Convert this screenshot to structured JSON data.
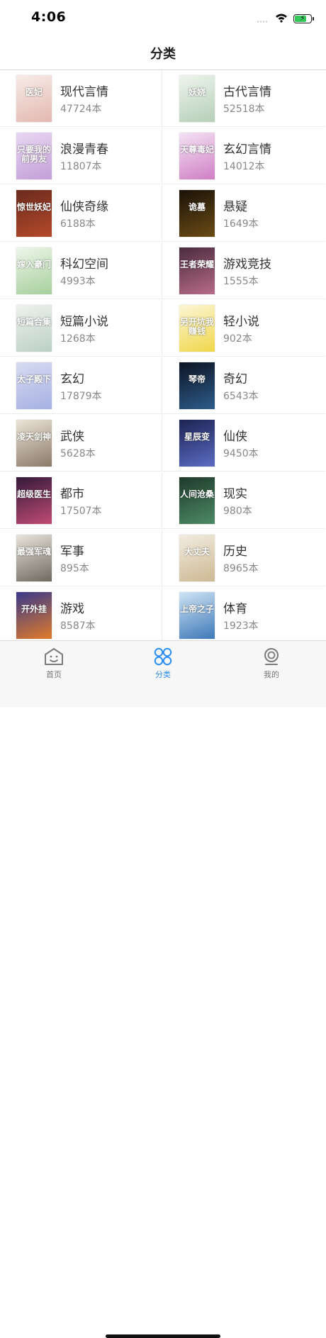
{
  "status": {
    "time": "4:06"
  },
  "nav": {
    "title": "分类"
  },
  "categories": [
    {
      "name": "现代言情",
      "count": "47724本",
      "cover_text": "医妃",
      "cover_colors": [
        "#f7ece8",
        "#e3b8b0"
      ]
    },
    {
      "name": "古代言情",
      "count": "52518本",
      "cover_text": "妖娆",
      "cover_colors": [
        "#eef4ec",
        "#b6cfb8"
      ]
    },
    {
      "name": "浪漫青春",
      "count": "11807本",
      "cover_text": "只要我的前男友",
      "cover_colors": [
        "#e8d7f2",
        "#c39fd8"
      ]
    },
    {
      "name": "玄幻言情",
      "count": "14012本",
      "cover_text": "天尊毒妃",
      "cover_colors": [
        "#f3e3f4",
        "#d07fc4"
      ]
    },
    {
      "name": "仙侠奇缘",
      "count": "6188本",
      "cover_text": "惊世妖妃",
      "cover_colors": [
        "#6a2a1d",
        "#b44a2b"
      ]
    },
    {
      "name": "悬疑",
      "count": "1649本",
      "cover_text": "诡墓",
      "cover_colors": [
        "#1a1208",
        "#6b4b15"
      ]
    },
    {
      "name": "科幻空间",
      "count": "4993本",
      "cover_text": "嫁入豪门",
      "cover_colors": [
        "#eef6ea",
        "#a6cf9c"
      ]
    },
    {
      "name": "游戏竞技",
      "count": "1555本",
      "cover_text": "王者荣耀",
      "cover_colors": [
        "#4a2c3d",
        "#b86b88"
      ]
    },
    {
      "name": "短篇小说",
      "count": "1268本",
      "cover_text": "短篇合集",
      "cover_colors": [
        "#eef2ee",
        "#bcd0c6"
      ]
    },
    {
      "name": "轻小说",
      "count": "902本",
      "cover_text": "另开坑我赚钱",
      "cover_colors": [
        "#fbf6d6",
        "#f0d74a"
      ]
    },
    {
      "name": "玄幻",
      "count": "17879本",
      "cover_text": "太子殿下",
      "cover_colors": [
        "#d7dcf2",
        "#a7b0e2"
      ]
    },
    {
      "name": "奇幻",
      "count": "6543本",
      "cover_text": "琴帝",
      "cover_colors": [
        "#0d1424",
        "#2d5c8a"
      ]
    },
    {
      "name": "武侠",
      "count": "5628本",
      "cover_text": "凌天剑神",
      "cover_colors": [
        "#ece4d8",
        "#8a7a68"
      ]
    },
    {
      "name": "仙侠",
      "count": "9450本",
      "cover_text": "星辰变",
      "cover_colors": [
        "#1d2352",
        "#5b6cc4"
      ]
    },
    {
      "name": "都市",
      "count": "17507本",
      "cover_text": "超级医生",
      "cover_colors": [
        "#341a3a",
        "#c04b74"
      ]
    },
    {
      "name": "现实",
      "count": "980本",
      "cover_text": "人间沧桑",
      "cover_colors": [
        "#1f3a2a",
        "#4d8a66"
      ]
    },
    {
      "name": "军事",
      "count": "895本",
      "cover_text": "最强军魂",
      "cover_colors": [
        "#e9e4dc",
        "#6f6a60"
      ]
    },
    {
      "name": "历史",
      "count": "8965本",
      "cover_text": "大丈夫",
      "cover_colors": [
        "#f2ede2",
        "#cdb892"
      ]
    },
    {
      "name": "游戏",
      "count": "8587本",
      "cover_text": "开外挂",
      "cover_colors": [
        "#3a3a8a",
        "#e07a2a"
      ]
    },
    {
      "name": "体育",
      "count": "1923本",
      "cover_text": "上帝之子",
      "cover_colors": [
        "#cfe4f4",
        "#3d78b8"
      ]
    }
  ],
  "tabs": [
    {
      "label": "首页",
      "icon": "home-face-icon",
      "active": false
    },
    {
      "label": "分类",
      "icon": "grid-category-icon",
      "active": true
    },
    {
      "label": "我的",
      "icon": "profile-icon",
      "active": false
    }
  ],
  "colors": {
    "accent": "#2d8ef5",
    "tab_inactive": "#777777"
  }
}
